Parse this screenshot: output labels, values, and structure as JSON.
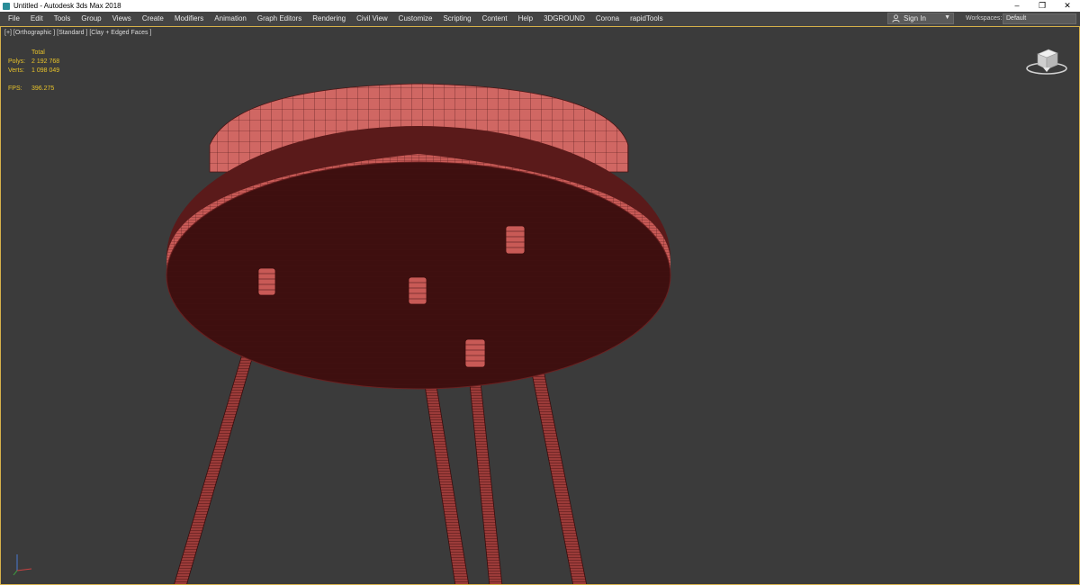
{
  "window": {
    "title": "Untitled - Autodesk 3ds Max 2018",
    "controls": [
      "–",
      "❐",
      "✕"
    ]
  },
  "menu": {
    "items": [
      "File",
      "Edit",
      "Tools",
      "Group",
      "Views",
      "Create",
      "Modifiers",
      "Animation",
      "Graph Editors",
      "Rendering",
      "Civil View",
      "Customize",
      "Scripting",
      "Content",
      "Help",
      "3DGROUND",
      "Corona",
      "rapidTools"
    ],
    "signin_label": "Sign In",
    "workspaces_label": "Workspaces:",
    "workspaces_value": "Default"
  },
  "viewport": {
    "label": "[+] [Orthographic ] [Standard ] [Clay + Edged Faces ]",
    "stats": {
      "header": "Total",
      "polys_label": "Polys:",
      "polys_value": "2 192 768",
      "verts_label": "Verts:",
      "verts_value": "1 098 049",
      "fps_label": "FPS:",
      "fps_value": "396.275"
    }
  },
  "colors": {
    "accent_yellow": "#e8c32a",
    "model_clay": "#c85a56",
    "model_shadow": "#3c0e0e"
  }
}
